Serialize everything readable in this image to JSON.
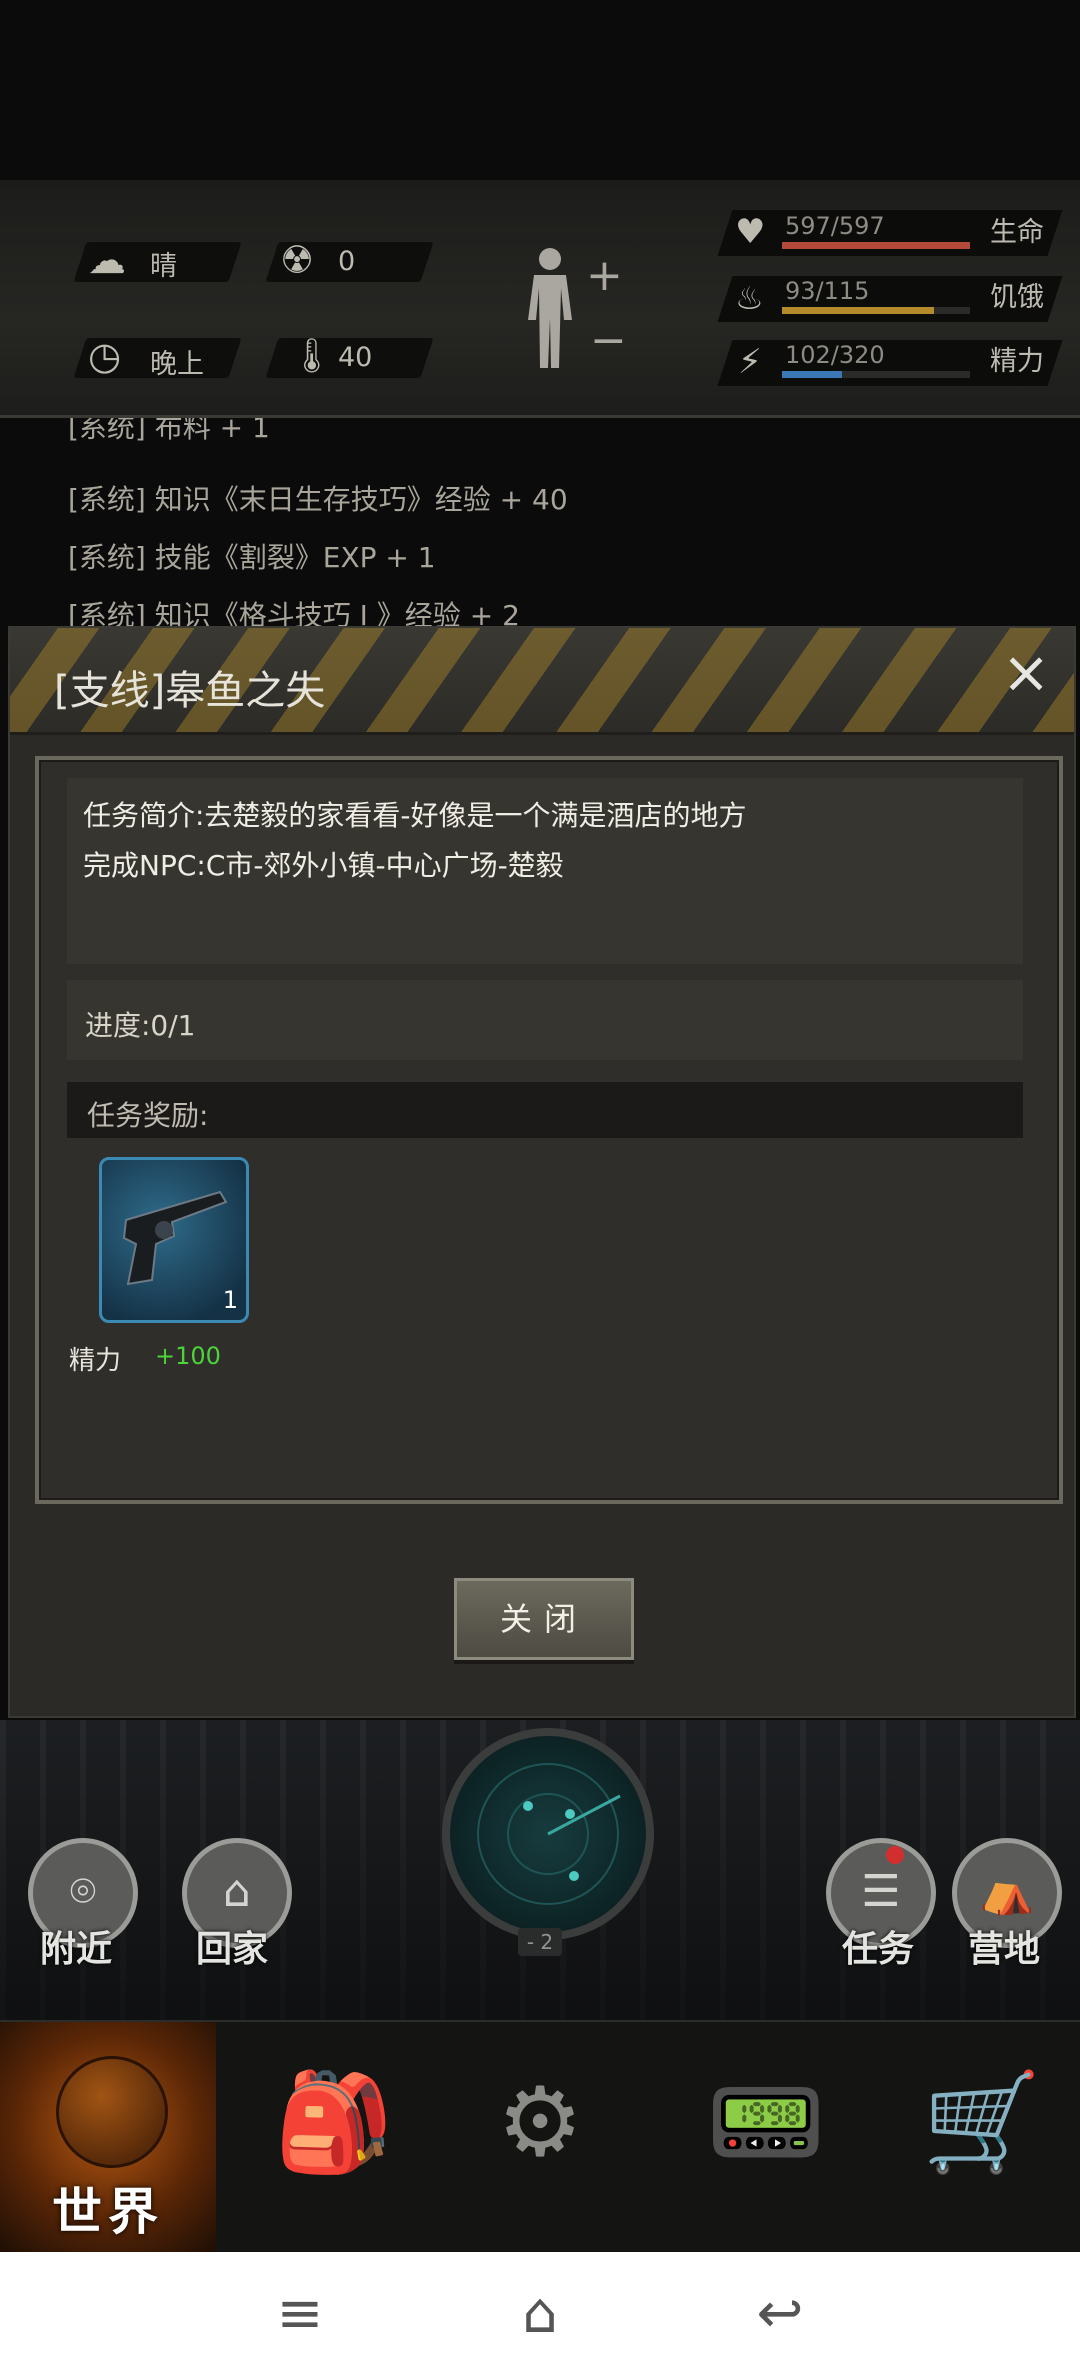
{
  "status": {
    "weather": "晴",
    "radiation": "0",
    "time_of_day": "晚上",
    "temperature": "40",
    "stats": [
      {
        "value": "597/597",
        "label": "生命",
        "fill": 1.0,
        "color": "#b54a3a",
        "icon": "heart-icon"
      },
      {
        "value": "93/115",
        "label": "饥饿",
        "fill": 0.81,
        "color": "#b58a2a",
        "icon": "stomach-icon"
      },
      {
        "value": "102/320",
        "label": "精力",
        "fill": 0.32,
        "color": "#3a78b5",
        "icon": "energy-icon"
      }
    ]
  },
  "log": [
    "[系统] 布料 + 1",
    "[系统] 知识《末日生存技巧》经验 + 40",
    "[系统] 技能《割裂》EXP + 1",
    "[系统] 知识《格斗技巧 I 》经验 + 2"
  ],
  "dialog": {
    "title": "[支线]皋鱼之失",
    "desc_line1": "任务简介:去楚毅的家看看-好像是一个满是酒店的地方",
    "desc_line2": "完成NPC:C市-郊外小镇-中心广场-楚毅",
    "progress": "进度:0/1",
    "rewards_label": "任务奖励:",
    "reward_item": {
      "name": "revolver-icon",
      "count": "1"
    },
    "reward_stat_label": "精力",
    "reward_stat_value": "+100",
    "close_label": "关闭"
  },
  "actions": {
    "nearby": "附近",
    "home": "回家",
    "tasks": "任务",
    "camp": "营地",
    "radar_level": "- 2"
  },
  "nav": {
    "world": "世界"
  }
}
